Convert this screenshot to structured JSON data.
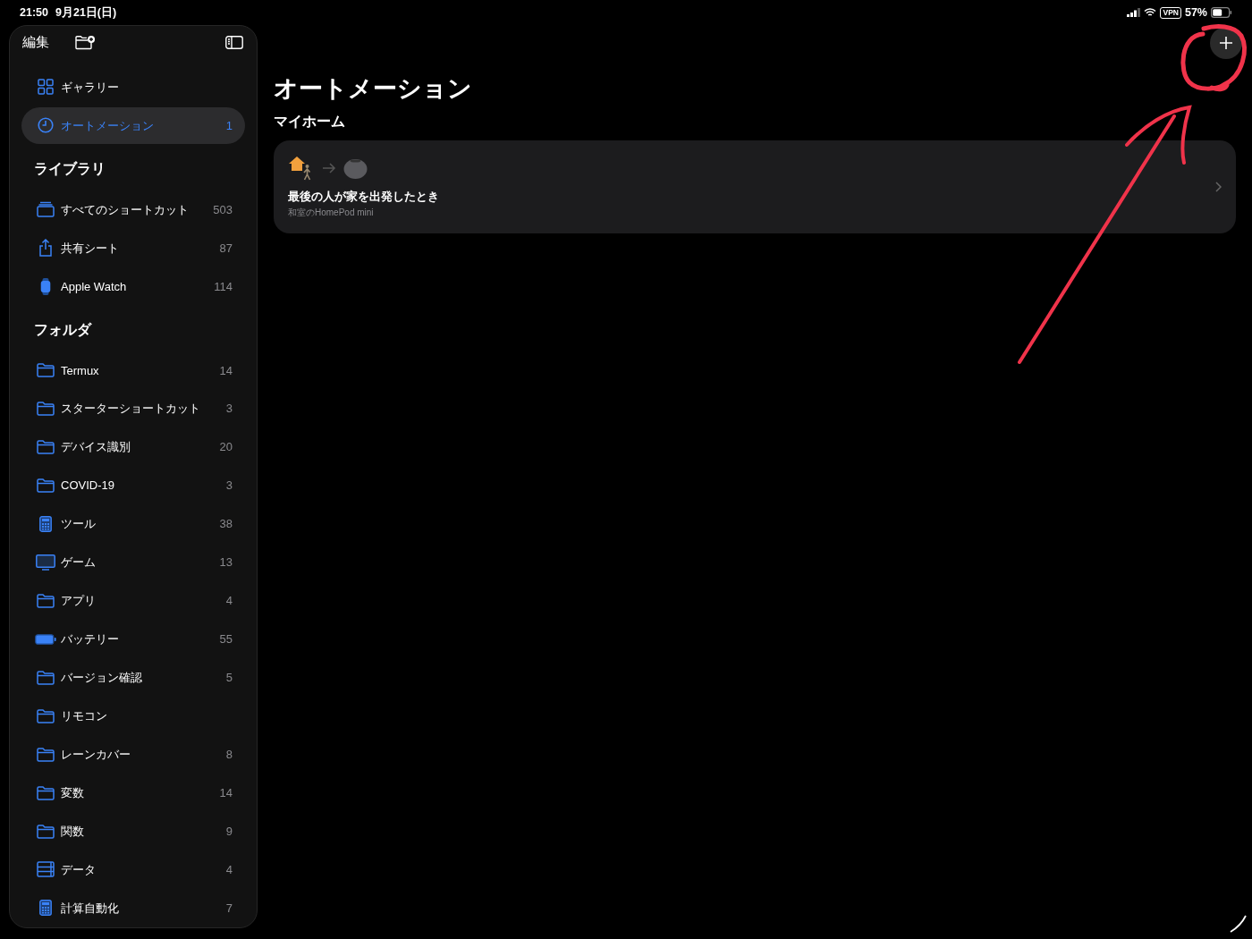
{
  "status_bar": {
    "time": "21:50",
    "date": "9月21日(日)",
    "vpn": "VPN",
    "battery": "57%"
  },
  "sidebar": {
    "edit": "編集",
    "top_items": [
      {
        "label": "ギャラリー",
        "kind": "grid",
        "selected": false
      },
      {
        "label": "オートメーション",
        "kind": "clock",
        "count": "1",
        "selected": true
      }
    ],
    "sections": [
      {
        "title": "ライブラリ",
        "items": [
          {
            "label": "すべてのショートカット",
            "kind": "stack",
            "count": "503",
            "selected": false
          },
          {
            "label": "共有シート",
            "kind": "share",
            "count": "87",
            "selected": false
          },
          {
            "label": "Apple Watch",
            "kind": "watch",
            "count": "114",
            "selected": false
          }
        ]
      },
      {
        "title": "フォルダ",
        "items": [
          {
            "label": "Termux",
            "kind": "folder",
            "count": "14",
            "selected": false
          },
          {
            "label": "スターターショートカット",
            "kind": "folder",
            "count": "3",
            "selected": false
          },
          {
            "label": "デバイス識別",
            "kind": "folder",
            "count": "20",
            "selected": false
          },
          {
            "label": "COVID-19",
            "kind": "folder",
            "count": "3",
            "selected": false
          },
          {
            "label": "ツール",
            "kind": "calculator",
            "count": "38",
            "selected": false
          },
          {
            "label": "ゲーム",
            "kind": "monitor",
            "count": "13",
            "selected": false
          },
          {
            "label": "アプリ",
            "kind": "folder",
            "count": "4",
            "selected": false
          },
          {
            "label": "バッテリー",
            "kind": "battery",
            "count": "55",
            "selected": false
          },
          {
            "label": "バージョン確認",
            "kind": "folder",
            "count": "5",
            "selected": false
          },
          {
            "label": "リモコン",
            "kind": "folder",
            "selected": false
          },
          {
            "label": "レーンカバー",
            "kind": "folder",
            "count": "8",
            "selected": false
          },
          {
            "label": "変数",
            "kind": "folder",
            "count": "14",
            "selected": false
          },
          {
            "label": "関数",
            "kind": "folder",
            "count": "9",
            "selected": false
          },
          {
            "label": "データ",
            "kind": "table",
            "count": "4",
            "selected": false
          },
          {
            "label": "計算自動化",
            "kind": "calculator",
            "count": "7",
            "selected": false
          }
        ]
      }
    ]
  },
  "main": {
    "title": "オートメーション",
    "section": "マイホーム",
    "automations": [
      {
        "title": "最後の人が家を出発したとき",
        "subtitle": "和室のHomePod mini"
      }
    ]
  }
}
